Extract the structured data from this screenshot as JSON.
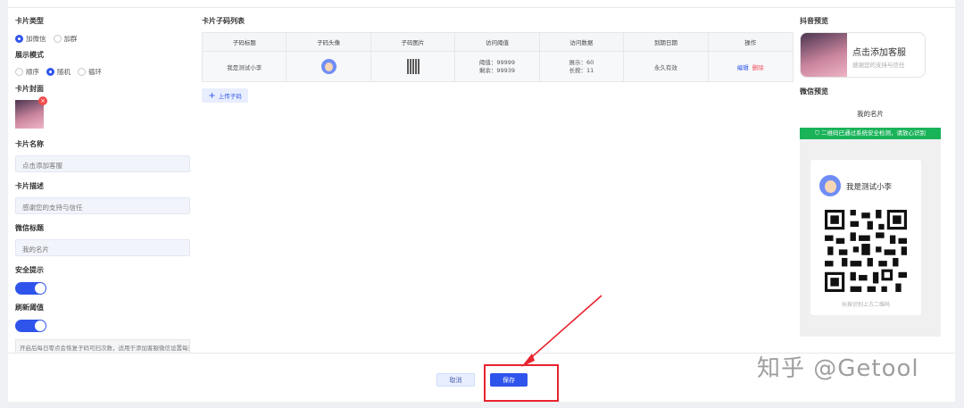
{
  "form": {
    "card_type_label": "卡片类型",
    "card_type_options": [
      "加微信",
      "加群"
    ],
    "display_mode_label": "展示模式",
    "display_mode_options": [
      "顺序",
      "随机",
      "循环"
    ],
    "cover_label": "卡片封面",
    "name_label": "卡片名称",
    "name_value": "点击添加客服",
    "desc_label": "卡片描述",
    "desc_value": "感谢您的支持与信任",
    "wx_title_label": "微信标题",
    "wx_title_value": "我的名片",
    "safety_label": "安全提示",
    "refresh_label": "刷新阈值",
    "refresh_hint": "开启后每日零点会恢复子码可扫次数，适用于添加客服微信设置每天可添加数…"
  },
  "table": {
    "title": "卡片子码列表",
    "headers": [
      "子码标题",
      "子码头像",
      "子码图片",
      "访问阈值",
      "访问数据",
      "到期日期",
      "操作"
    ],
    "row": {
      "title": "我是测试小李",
      "threshold_a": "阈值：99999",
      "threshold_b": "剩余：99939",
      "data_a": "展示：60",
      "data_b": "长按：11",
      "expire": "永久有效",
      "edit": "编辑",
      "delete": "删除"
    },
    "upload_label": "上传子码"
  },
  "preview": {
    "douyin_label": "抖音预览",
    "douyin_title": "点击添加客服",
    "douyin_sub": "感谢您的支持与信任",
    "wechat_label": "微信预览",
    "wechat_head": "我的名片",
    "wechat_bar": "二维码已通过系统安全检测，请放心识别",
    "wechat_name": "我是测试小李",
    "wechat_tip": "长按识别上方二维码"
  },
  "footer": {
    "cancel": "取消",
    "save": "保存"
  },
  "watermark": "知乎 @Getool",
  "colors": {
    "primary": "#2f54eb",
    "success": "#19b35a",
    "danger": "#e8242e"
  }
}
